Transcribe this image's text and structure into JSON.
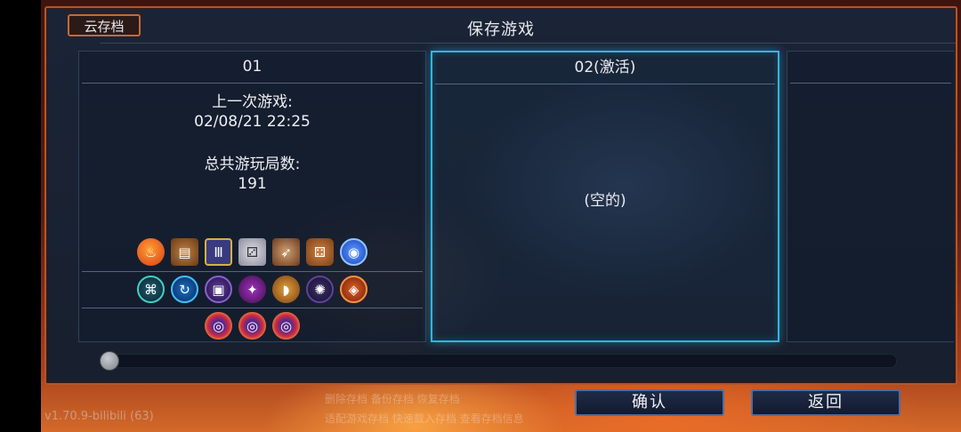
{
  "header": {
    "title": "保存游戏",
    "cloud_save_label": "云存档"
  },
  "slots": [
    {
      "name": "01",
      "last_played_label": "上一次游戏:",
      "last_played_value": "02/08/21  22:25",
      "total_runs_label": "总共游玩局数:",
      "total_runs_value": "191"
    },
    {
      "name": "02(激活)",
      "empty_label": "(空的)"
    }
  ],
  "buttons": {
    "confirm": "确认",
    "back": "返回"
  },
  "version": "v1.70.9-bilibili (63)",
  "overlay_text": [
    "删除存档 备份存档 恢复存档",
    "适配游戏存档 快速载入存档 查看存档信息"
  ],
  "scroll_position": 0.0,
  "colors": {
    "accent": "#2fb6e0",
    "frame": "#b4552a",
    "button_border": "#4a6ea8"
  },
  "icons": {
    "row1": [
      "fire-potion-icon",
      "treasure-chest-icon",
      "scroll-icon",
      "dice-sword-icon",
      "bow-dice-icon",
      "barrel-dice-icon",
      "blue-shield-icon"
    ],
    "row2": [
      "teleport-rune-icon",
      "blue-swirl-rune-icon",
      "cube-rune-icon",
      "purple-feather-icon",
      "golden-horn-icon",
      "spider-rune-icon",
      "orange-gem-icon"
    ],
    "row3": [
      "red-amulet-icon",
      "red-amulet-icon",
      "red-amulet-icon"
    ]
  }
}
